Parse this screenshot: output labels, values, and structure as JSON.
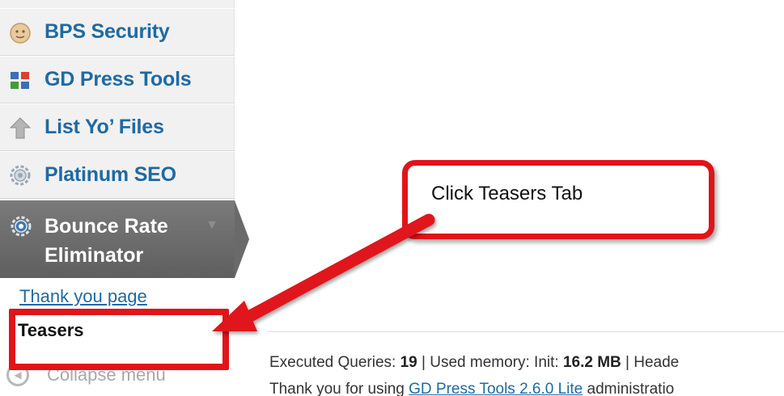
{
  "sidebar": {
    "items": [
      {
        "label": "BPS Security",
        "icon": "shield-face-icon"
      },
      {
        "label": "GD Press Tools",
        "icon": "press-tools-icon"
      },
      {
        "label": "List Yo’ Files",
        "icon": "upload-arrow-icon"
      },
      {
        "label": "Platinum SEO",
        "icon": "gear-icon"
      }
    ],
    "active": {
      "line1": "Bounce Rate",
      "line2": "Eliminator",
      "icon": "gear-icon"
    },
    "submenu": {
      "thank_you": "Thank you page",
      "teasers": "Teasers"
    },
    "collapse": "Collapse menu"
  },
  "footer": {
    "q_label": "Executed Queries: ",
    "q_value": "19",
    "mem_label": " | Used memory: Init: ",
    "mem_value": "16.2 MB",
    "trail": " | Heade",
    "thanks_prefix": "Thank you for using ",
    "thanks_link": "GD Press Tools 2.6.0 Lite",
    "thanks_suffix": " administratio"
  },
  "callout": {
    "text": "Click Teasers Tab"
  },
  "colors": {
    "highlight": "#e0141a",
    "link": "#1f6aa3",
    "active_bg": "#6a6a6a"
  }
}
